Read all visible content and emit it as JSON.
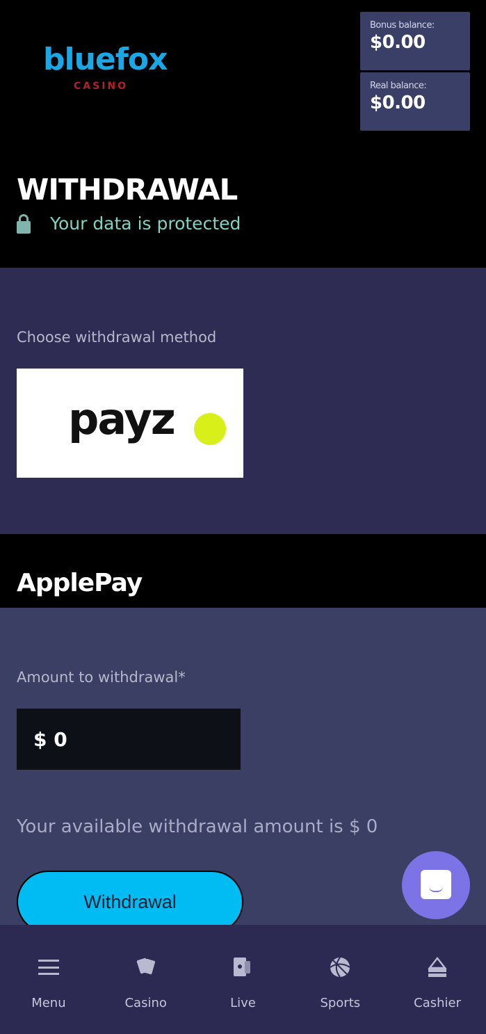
{
  "header": {
    "logo": {
      "brand": "bluefox",
      "sub": "CASINO"
    },
    "bonus_balance": {
      "label": "Bonus balance:",
      "value": "$0.00"
    },
    "real_balance": {
      "label": "Real balance:",
      "value": "$0.00"
    },
    "page_title": "WITHDRAWAL",
    "protected_text": "Your data is protected"
  },
  "method": {
    "label": "Choose withdrawal method",
    "options": [
      {
        "name": "payz"
      }
    ]
  },
  "selected_method": {
    "title": "ApplePay"
  },
  "amount": {
    "label": "Amount to withdrawal*",
    "value": "$ 0",
    "available_text": "Your available withdrawal amount is $ 0",
    "submit_label": "Withdrawal"
  },
  "colors": {
    "accent": "#00bcf2",
    "brand": "#1aa7e6",
    "chat": "#7b73e6",
    "payz_dot": "#d9ef1a"
  },
  "bottom_nav": {
    "items": [
      {
        "label": "Menu",
        "icon": "menu-icon"
      },
      {
        "label": "Casino",
        "icon": "cards-icon"
      },
      {
        "label": "Live",
        "icon": "live-cards-icon"
      },
      {
        "label": "Sports",
        "icon": "ball-icon"
      },
      {
        "label": "Cashier",
        "icon": "cashier-icon"
      }
    ]
  }
}
